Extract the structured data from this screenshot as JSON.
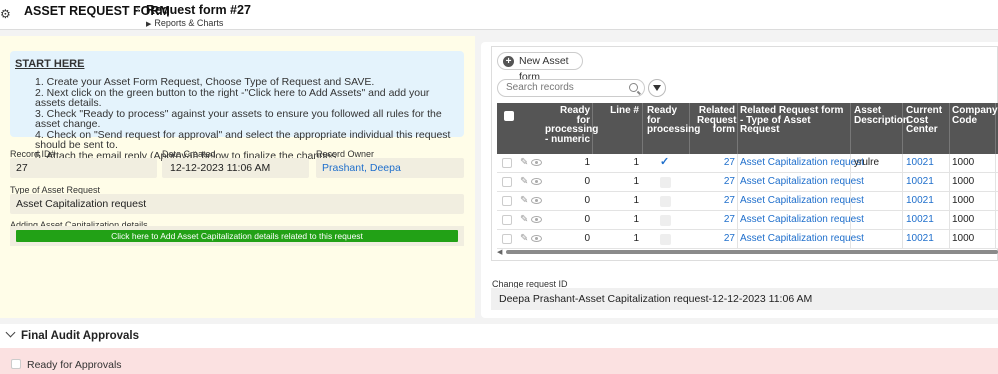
{
  "header": {
    "app_title": "ASSET REQUEST FORM",
    "form_title": "Request form #27",
    "sub_link": "Reports & Charts"
  },
  "start_here": {
    "title": "START HERE",
    "steps": [
      "1. Create your Asset Form Request, Choose Type of Request and SAVE.",
      "2. Next click on the green button to the right -\"Click here to Add Assets\" and add your assets details.",
      "3. Check \"Ready to process\" against your assets to ensure you followed all rules for the asset change.",
      "4. Check on \"Send request for approval\" and select the appropriate individual this request should be sent to.",
      "5. Attach the email reply (Approval) below to finalize the changes."
    ]
  },
  "record": {
    "record_id_label": "Record ID#",
    "record_id": "27",
    "date_label": "Date Created",
    "date": "12-12-2023 11:06 AM",
    "owner_label": "Record Owner",
    "owner": "Prashant, Deepa",
    "type_label": "Type of Asset Request",
    "type": "Asset Capitalization request",
    "adding_label": "Adding Asset Capitalization details",
    "green_button": "Click here to Add Asset Capitalization details related to this request"
  },
  "grid": {
    "new_button": "New Asset form",
    "search_placeholder": "Search records",
    "columns": {
      "ready_numeric": "Ready for processing - numeric",
      "line": "Line #",
      "ready": "Ready for processing",
      "related": "Related Request form",
      "related_type": "Related Request form - Type of Asset Request",
      "asset_desc": "Asset Description",
      "cost_center": "Current Cost Center",
      "company_code": "Company Code"
    },
    "rows": [
      {
        "ready_numeric": "1",
        "line": "1",
        "ready": true,
        "related": "27",
        "related_type": "Asset Capitalization request",
        "asset_desc": "yrulre",
        "cost_center": "10021",
        "company_code": "1000"
      },
      {
        "ready_numeric": "0",
        "line": "1",
        "ready": false,
        "related": "27",
        "related_type": "Asset Capitalization request",
        "asset_desc": "",
        "cost_center": "10021",
        "company_code": "1000"
      },
      {
        "ready_numeric": "0",
        "line": "1",
        "ready": false,
        "related": "27",
        "related_type": "Asset Capitalization request",
        "asset_desc": "",
        "cost_center": "10021",
        "company_code": "1000"
      },
      {
        "ready_numeric": "0",
        "line": "1",
        "ready": false,
        "related": "27",
        "related_type": "Asset Capitalization request",
        "asset_desc": "",
        "cost_center": "10021",
        "company_code": "1000"
      },
      {
        "ready_numeric": "0",
        "line": "1",
        "ready": false,
        "related": "27",
        "related_type": "Asset Capitalization request",
        "asset_desc": "",
        "cost_center": "10021",
        "company_code": "1000"
      }
    ]
  },
  "change_request": {
    "label": "Change request ID",
    "value": "Deepa Prashant-Asset Capitalization request-12-12-2023 11:06 AM"
  },
  "audit": {
    "title": "Final Audit Approvals",
    "ready_label": "Ready for Approvals"
  },
  "colors": {
    "accent_green": "#22a116",
    "link_blue": "#1f6fcc",
    "header_gray": "#555555"
  }
}
